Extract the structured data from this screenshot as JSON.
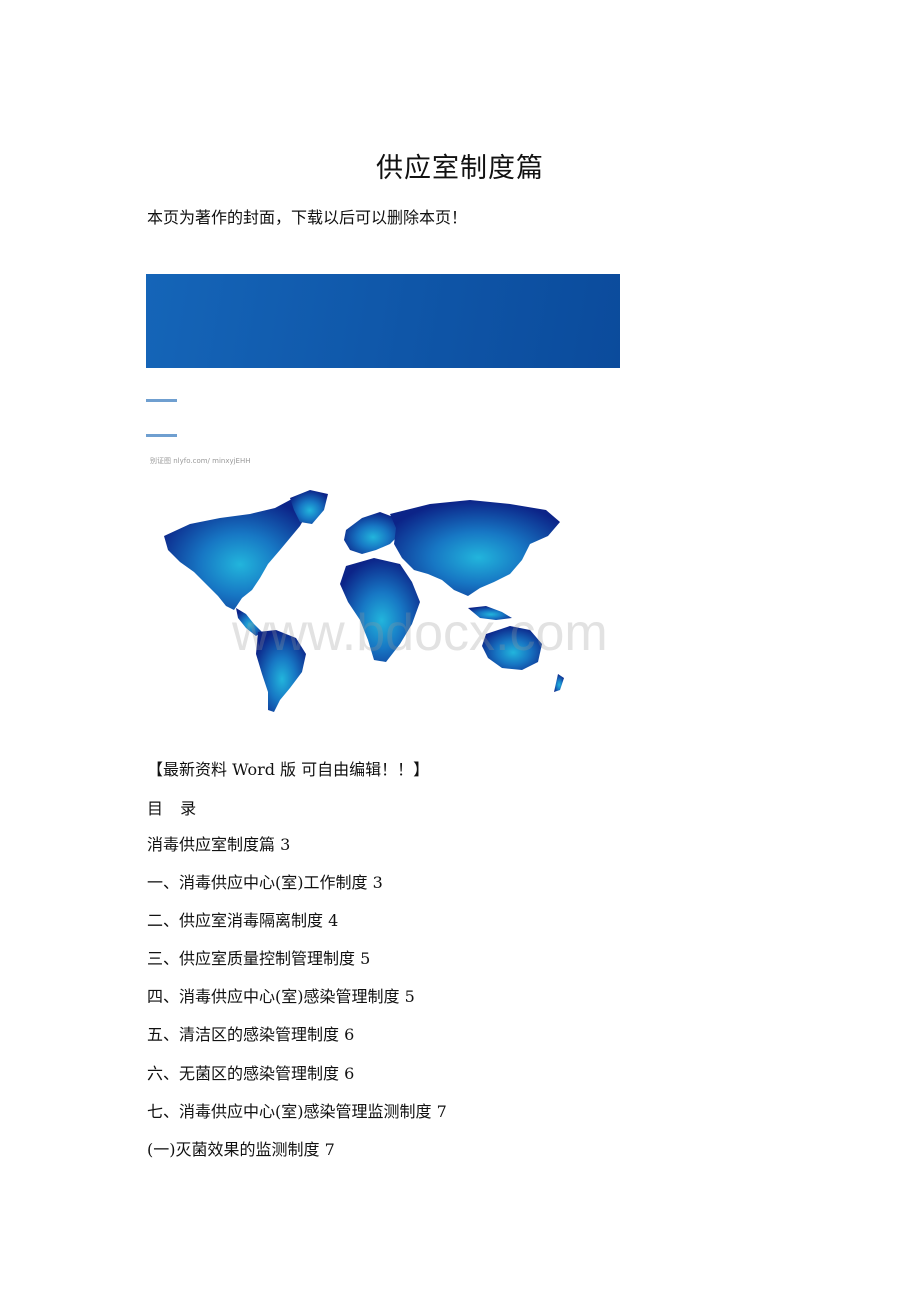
{
  "document": {
    "title": "供应室制度篇",
    "cover_note": "本页为著作的封面，下载以后可以删除本页！",
    "image_caption": "别证图 nlyfo.com/ minxyjEHH",
    "watermark": "www.bdocx.com",
    "promo": "【最新资料 Word 版 可自由编辑！！】",
    "toc_heading": "目 录",
    "toc": [
      "消毒供应室制度篇 3",
      "一、消毒供应中心(室)工作制度 3",
      "二、供应室消毒隔离制度 4",
      "三、供应室质量控制管理制度 5",
      "四、消毒供应中心(室)感染管理制度 5",
      "五、清洁区的感染管理制度 6",
      "六、无菌区的感染管理制度 6",
      "七、消毒供应中心(室)感染管理监测制度 7",
      "(一)灭菌效果的监测制度 7"
    ]
  },
  "colors": {
    "banner": "#1260b2",
    "rule": "#6f9fd0",
    "map_dark": "#0d2a8c",
    "map_light": "#1aa0d0"
  }
}
